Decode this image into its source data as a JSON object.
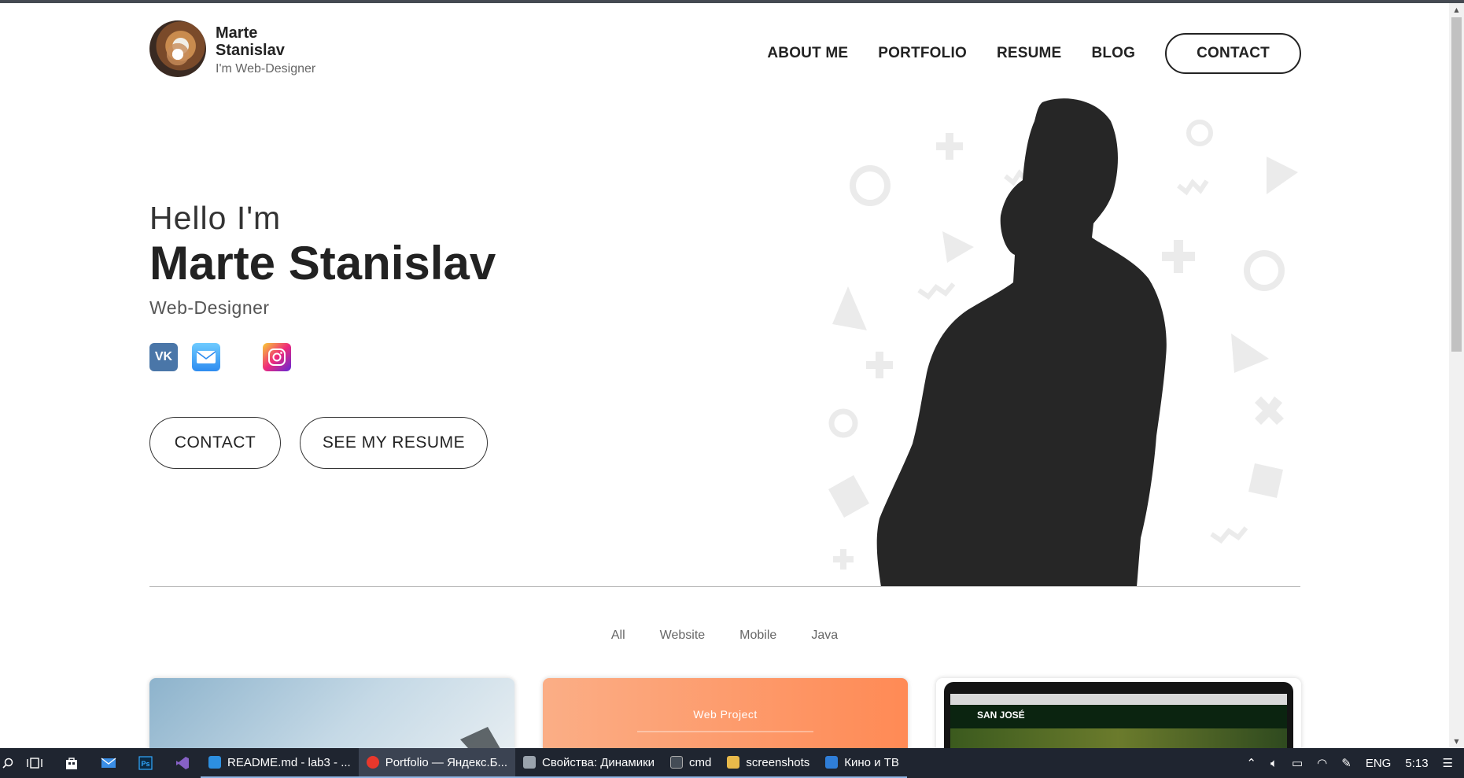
{
  "site": {
    "brand": {
      "name": "Marte Stanislav",
      "subtitle": "I'm Web-Designer"
    },
    "nav": {
      "about": "ABOUT ME",
      "portfolio": "PORTFOLIO",
      "resume": "RESUME",
      "blog": "BLOG",
      "contact": "CONTACT"
    },
    "hero": {
      "greeting": "Hello I'm",
      "name": "Marte Stanislav",
      "role": "Web-Designer",
      "socials": [
        {
          "icon": "vk-icon",
          "label": "VK"
        },
        {
          "icon": "mail-icon"
        },
        {
          "icon": "instagram-icon"
        }
      ],
      "contact_button": "CONTACT",
      "resume_button": "SEE MY RESUME"
    },
    "filters": [
      "All",
      "Website",
      "Mobile",
      "Java"
    ],
    "cards": [
      {
        "caption": ""
      },
      {
        "caption": "Web Project"
      },
      {
        "caption": "SAN JOSÉ"
      }
    ]
  },
  "taskbar": {
    "items": [
      {
        "label": "README.md - lab3 - ...",
        "state": "open",
        "icon_color": "#2d8fe0"
      },
      {
        "label": "Portfolio — Яндекс.Б...",
        "state": "active",
        "icon_color": "#e8382c"
      },
      {
        "label": "Свойства: Динамики",
        "state": "open",
        "icon_color": "#9aa3ad"
      },
      {
        "label": "cmd",
        "state": "open",
        "icon_color": "#444c56"
      },
      {
        "label": "screenshots",
        "state": "open",
        "icon_color": "#e8b94a"
      },
      {
        "label": "Кино и ТВ",
        "state": "open",
        "icon_color": "#2f7ed8"
      }
    ],
    "language": "ENG",
    "time": "5:13"
  },
  "colors": {
    "text": "#222222",
    "taskbar": "#1f2530",
    "accent_underline": "#8fb4e3"
  }
}
